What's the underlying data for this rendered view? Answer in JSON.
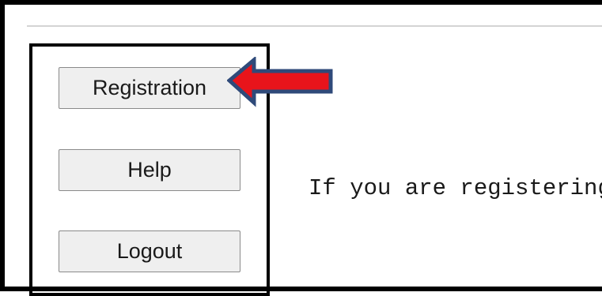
{
  "sidebar": {
    "buttons": [
      {
        "label": "Registration"
      },
      {
        "label": "Help"
      },
      {
        "label": "Logout"
      }
    ]
  },
  "main": {
    "intro_text": "If you are registering"
  },
  "annotation": {
    "arrow_color": "#e8141b",
    "arrow_outline_color": "#2f4a7a"
  },
  "colors": {
    "frame": "#000000",
    "button_bg": "#efefef",
    "button_border": "#8a8a8a"
  }
}
